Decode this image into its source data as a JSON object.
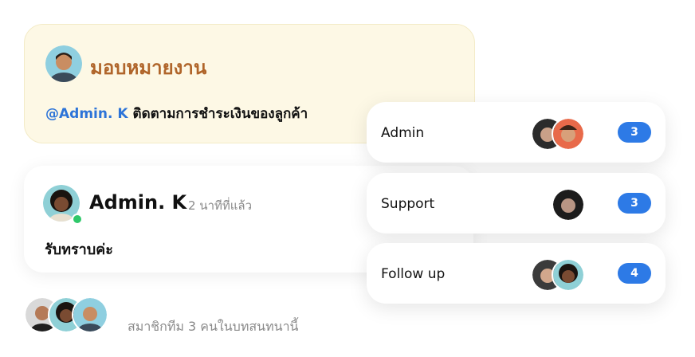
{
  "assignment": {
    "title": "มอบหมายงาน",
    "mention": "@Admin. K",
    "task": "ติดตามการชำระเงินของลูกค้า"
  },
  "comment": {
    "author": "Admin. K",
    "time": "2 นาทีที่แล้ว",
    "text": "รับทราบค่ะ",
    "status": "online"
  },
  "members": {
    "summary": "สมาชิกทีม 3 คนในบทสนทนานี้"
  },
  "teams": [
    {
      "name": "Admin",
      "count": "3"
    },
    {
      "name": "Support",
      "count": "3"
    },
    {
      "name": "Follow up",
      "count": "4"
    }
  ],
  "colors": {
    "accent": "#2d7ae6",
    "assign_title": "#b0652a",
    "mention": "#2d74d8",
    "online": "#2fc86a",
    "assign_bg": "#fdf8e5"
  }
}
